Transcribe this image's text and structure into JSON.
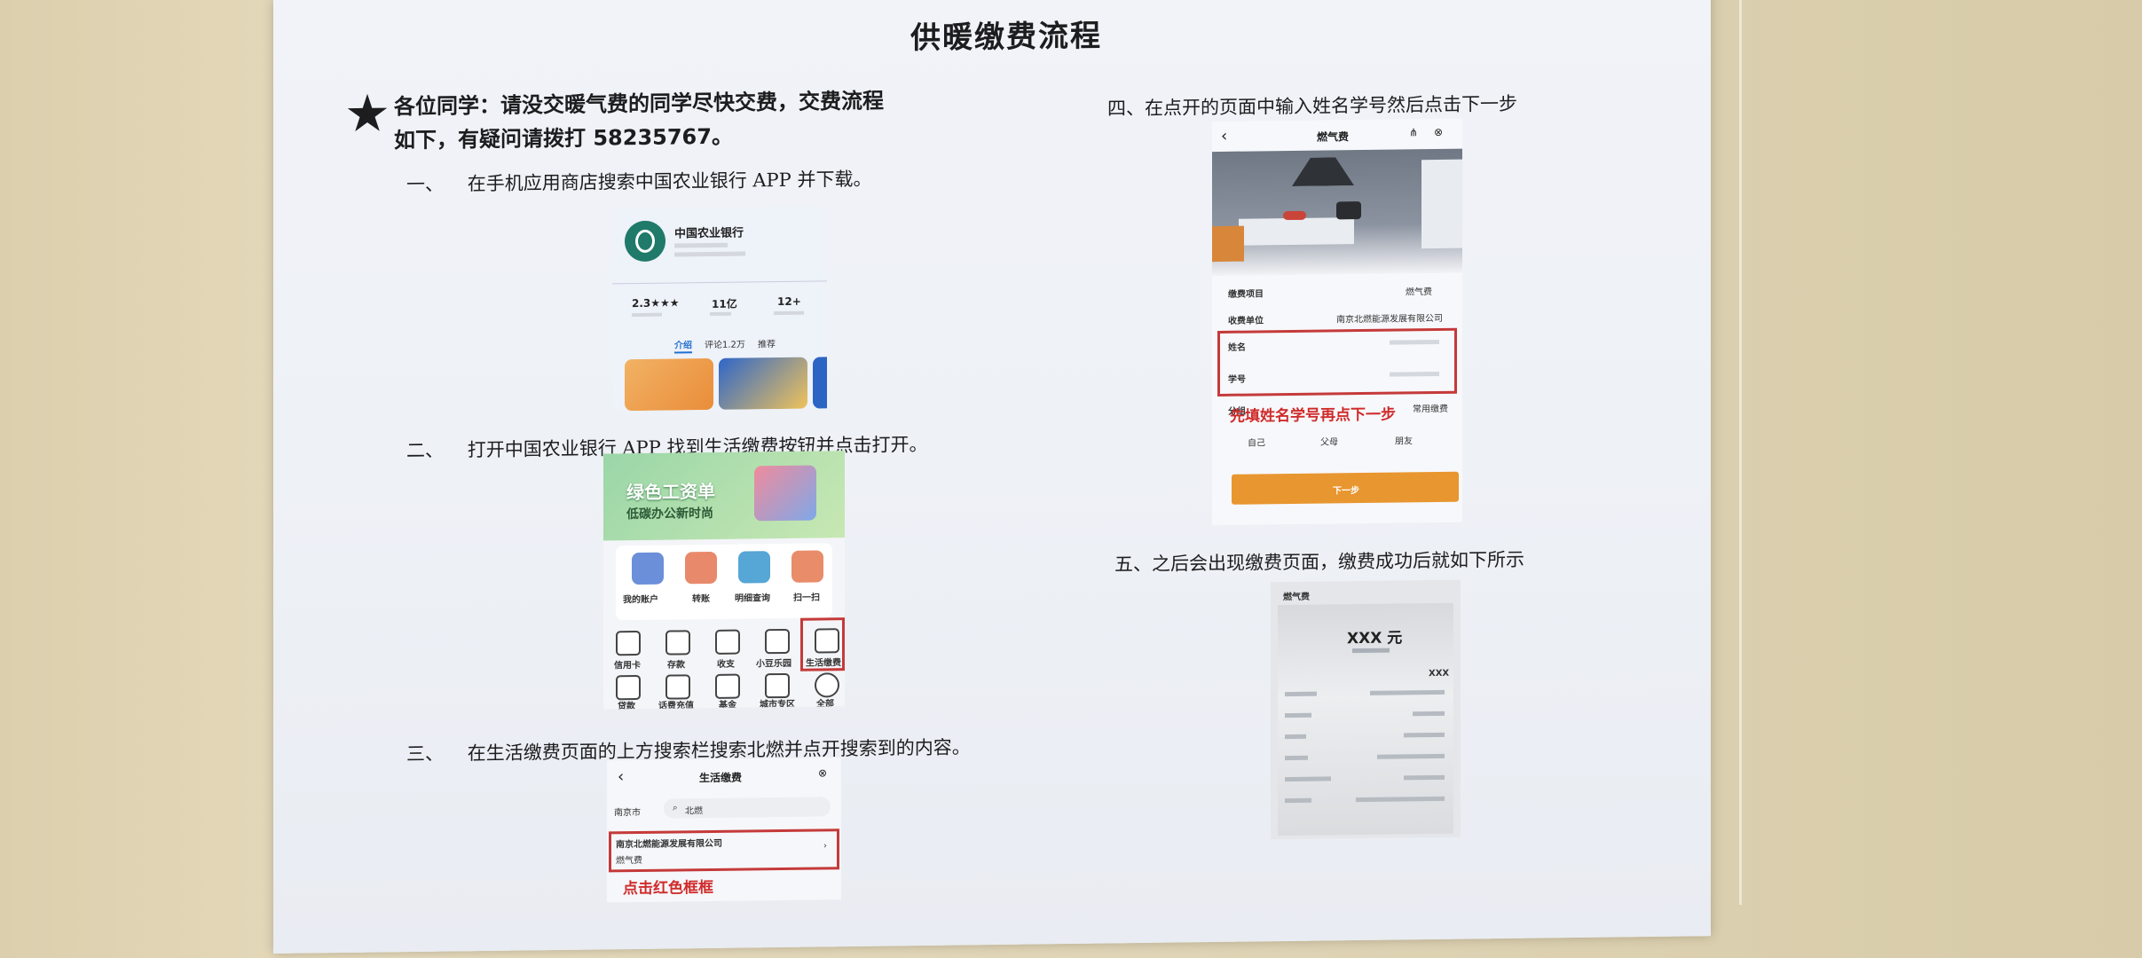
{
  "title": "供暖缴费流程",
  "intro": {
    "star": "★",
    "line1": "各位同学：请没交暖气费的同学尽快交费，交费流程",
    "line2": "如下，有疑问请拨打 58235767。"
  },
  "steps": [
    {
      "num": "一、",
      "text": "在手机应用商店搜索中国农业银行 APP 并下载。"
    },
    {
      "num": "二、",
      "text": "打开中国农业银行 APP 找到生活缴费按钮并点击打开。"
    },
    {
      "num": "三、",
      "text": "在生活缴费页面的上方搜索栏搜索北燃并点开搜索到的内容。"
    },
    {
      "num": "四、",
      "text": "在点开的页面中输入姓名学号然后点击下一步"
    },
    {
      "num": "五、",
      "text": "之后会出现缴费页面，缴费成功后就如下所示"
    }
  ],
  "shot1": {
    "app_name": "中国农业银行",
    "rating": "2.3",
    "downloads": "11亿",
    "age": "12+",
    "tabs": [
      "介绍",
      "评论1.2万",
      "推荐"
    ]
  },
  "shot2": {
    "banner": "绿色工资单",
    "banner_sub": "低碳办公新时尚",
    "row1": [
      "我的账户",
      "转账",
      "明细查询",
      "扫一扫"
    ],
    "row2": [
      "信用卡",
      "存款",
      "收支",
      "小豆乐园",
      "生活缴费"
    ],
    "row3": [
      "贷款",
      "话费充值",
      "基金",
      "城市专区",
      "全部"
    ]
  },
  "shot3": {
    "header": "生活缴费",
    "back": "‹",
    "city": "南京市",
    "search": "北燃",
    "result": "南京北燃能源发展有限公司",
    "result_sub": "燃气费",
    "note": "点击红色框框"
  },
  "shot4": {
    "header": "燃气费",
    "back": "‹",
    "rows": [
      {
        "label": "缴费项目",
        "value": "燃气费"
      },
      {
        "label": "收费单位",
        "value": "南京北燃能源发展有限公司"
      }
    ],
    "name_label": "姓名",
    "id_label": "学号",
    "hint": "先填姓名学号再点下一步",
    "group_label": "分组",
    "group_value": "常用缴费",
    "chips": [
      "自己",
      "父母",
      "朋友"
    ],
    "next": "下一步"
  },
  "shot5": {
    "header": "燃气费",
    "amount": "XXX 元",
    "amount_sub": "XXX"
  }
}
